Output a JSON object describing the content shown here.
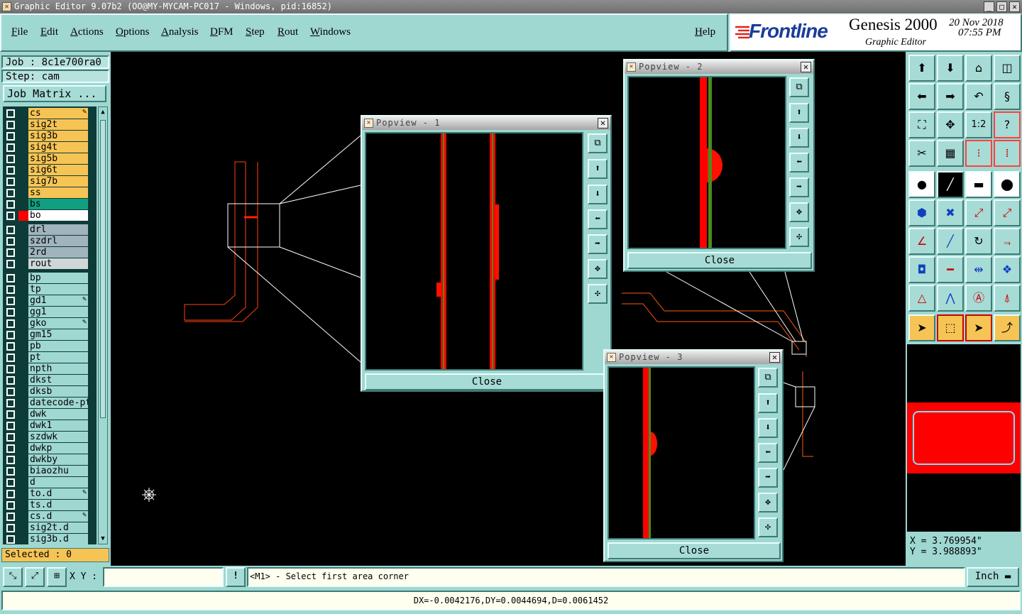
{
  "window": {
    "title": "Graphic Editor 9.07b2 (OO@MY-MYCAM-PC017 - Windows, pid:16852)",
    "min": "_",
    "max": "□",
    "close": "✕"
  },
  "menu": [
    "File",
    "Edit",
    "Actions",
    "Options",
    "Analysis",
    "DFM",
    "Step",
    "Rout",
    "Windows"
  ],
  "help": "Help",
  "brand": {
    "logo": "Frontline",
    "product": "Genesis 2000",
    "subtitle": "Graphic Editor",
    "date": "20 Nov 2018",
    "time": "07:55 PM"
  },
  "job": {
    "label": "Job : 8c1e700ra0",
    "step": "Step: cam",
    "matrix_button": "Job Matrix ..."
  },
  "layers": [
    {
      "name": "cs",
      "color": "#f6c455",
      "mark": "✎"
    },
    {
      "name": "sig2t",
      "color": "#f6c455"
    },
    {
      "name": "sig3b",
      "color": "#f6c455"
    },
    {
      "name": "sig4t",
      "color": "#f6c455"
    },
    {
      "name": "sig5b",
      "color": "#f6c455"
    },
    {
      "name": "sig6t",
      "color": "#f6c455"
    },
    {
      "name": "sig7b",
      "color": "#f6c455"
    },
    {
      "name": "ss",
      "color": "#f6c455"
    },
    {
      "name": "bs",
      "color": "#10a080"
    },
    {
      "name": "bo",
      "color": "#ffffff",
      "active": "#ff0000"
    },
    {
      "name": "drl",
      "color": "#a0b4be"
    },
    {
      "name": "szdrl",
      "color": "#a0b4be"
    },
    {
      "name": "2rd",
      "color": "#a0b4be"
    },
    {
      "name": "rout",
      "color": "#cfd6d8"
    },
    {
      "name": "bp",
      "color": "#9fd7d1"
    },
    {
      "name": "tp",
      "color": "#9fd7d1"
    },
    {
      "name": "gd1",
      "color": "#9fd7d1",
      "mark": "✎"
    },
    {
      "name": "gg1",
      "color": "#9fd7d1"
    },
    {
      "name": "gko",
      "color": "#9fd7d1",
      "mark": "✎"
    },
    {
      "name": "gm15",
      "color": "#9fd7d1"
    },
    {
      "name": "pb",
      "color": "#9fd7d1"
    },
    {
      "name": "pt",
      "color": "#9fd7d1"
    },
    {
      "name": "npth",
      "color": "#9fd7d1"
    },
    {
      "name": "dkst",
      "color": "#9fd7d1"
    },
    {
      "name": "dksb",
      "color": "#9fd7d1"
    },
    {
      "name": "datecode-ptc",
      "color": "#9fd7d1"
    },
    {
      "name": "dwk",
      "color": "#9fd7d1"
    },
    {
      "name": "dwk1",
      "color": "#9fd7d1"
    },
    {
      "name": "szdwk",
      "color": "#9fd7d1"
    },
    {
      "name": "dwkp",
      "color": "#9fd7d1"
    },
    {
      "name": "dwkby",
      "color": "#9fd7d1"
    },
    {
      "name": "biaozhu",
      "color": "#9fd7d1"
    },
    {
      "name": "d",
      "color": "#9fd7d1"
    },
    {
      "name": "to.d",
      "color": "#9fd7d1",
      "mark": "✎"
    },
    {
      "name": "ts.d",
      "color": "#9fd7d1"
    },
    {
      "name": "cs.d",
      "color": "#9fd7d1",
      "mark": "✎"
    },
    {
      "name": "sig2t.d",
      "color": "#9fd7d1"
    },
    {
      "name": "sig3b.d",
      "color": "#9fd7d1"
    }
  ],
  "selected": "Selected : 0",
  "popups": [
    {
      "title": "Popview - 1",
      "close": "Close"
    },
    {
      "title": "Popview - 2",
      "close": "Close"
    },
    {
      "title": "Popview - 3",
      "close": "Close"
    }
  ],
  "coords": {
    "x": "X = 3.769954\"",
    "y": "Y = 3.988893\""
  },
  "status": {
    "xy_label": "X Y :",
    "xy_value": "",
    "warn": "!",
    "prompt": "<M1> - Select first area corner",
    "unit": "Inch"
  },
  "measure": "DX=-0.0042176,DY=0.0044694,D=0.0061452",
  "icons": {
    "crosshair": "crosshair-icon"
  }
}
